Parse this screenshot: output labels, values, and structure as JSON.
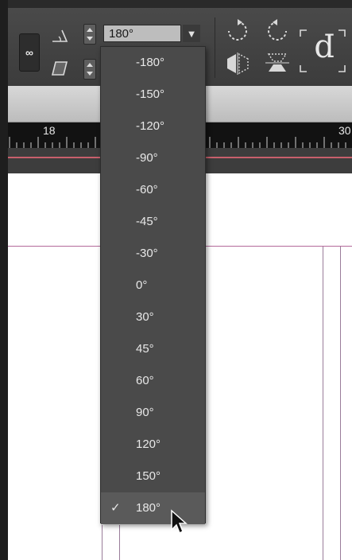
{
  "toolbar": {
    "rotation_field_value": "180°",
    "constrain_icon": "chain-link-icon",
    "rotation_icon": "rotation-angle-icon",
    "shear_icon": "shear-angle-icon",
    "rotate_cw_icon": "rotate-clockwise-icon",
    "rotate_ccw_icon": "rotate-counterclockwise-icon",
    "flip_h_icon": "flip-horizontal-icon",
    "flip_v_icon": "flip-vertical-icon",
    "reference_point_glyph": "p"
  },
  "ruler": {
    "labels": [
      "18",
      "30"
    ]
  },
  "rotation_menu": {
    "options": [
      "-180°",
      "-150°",
      "-120°",
      "-90°",
      "-60°",
      "-45°",
      "-30°",
      "0°",
      "30°",
      "45°",
      "60°",
      "90°",
      "120°",
      "150°",
      "180°"
    ],
    "selected": "180°",
    "check_glyph": "✓"
  },
  "colors": {
    "control_bar": "#3c3c3c",
    "menu_bg": "#4a4a4a",
    "field_bg": "#bdbdbd",
    "guide_magenta": "#b36a9a",
    "ruler_red": "#c8606c"
  }
}
